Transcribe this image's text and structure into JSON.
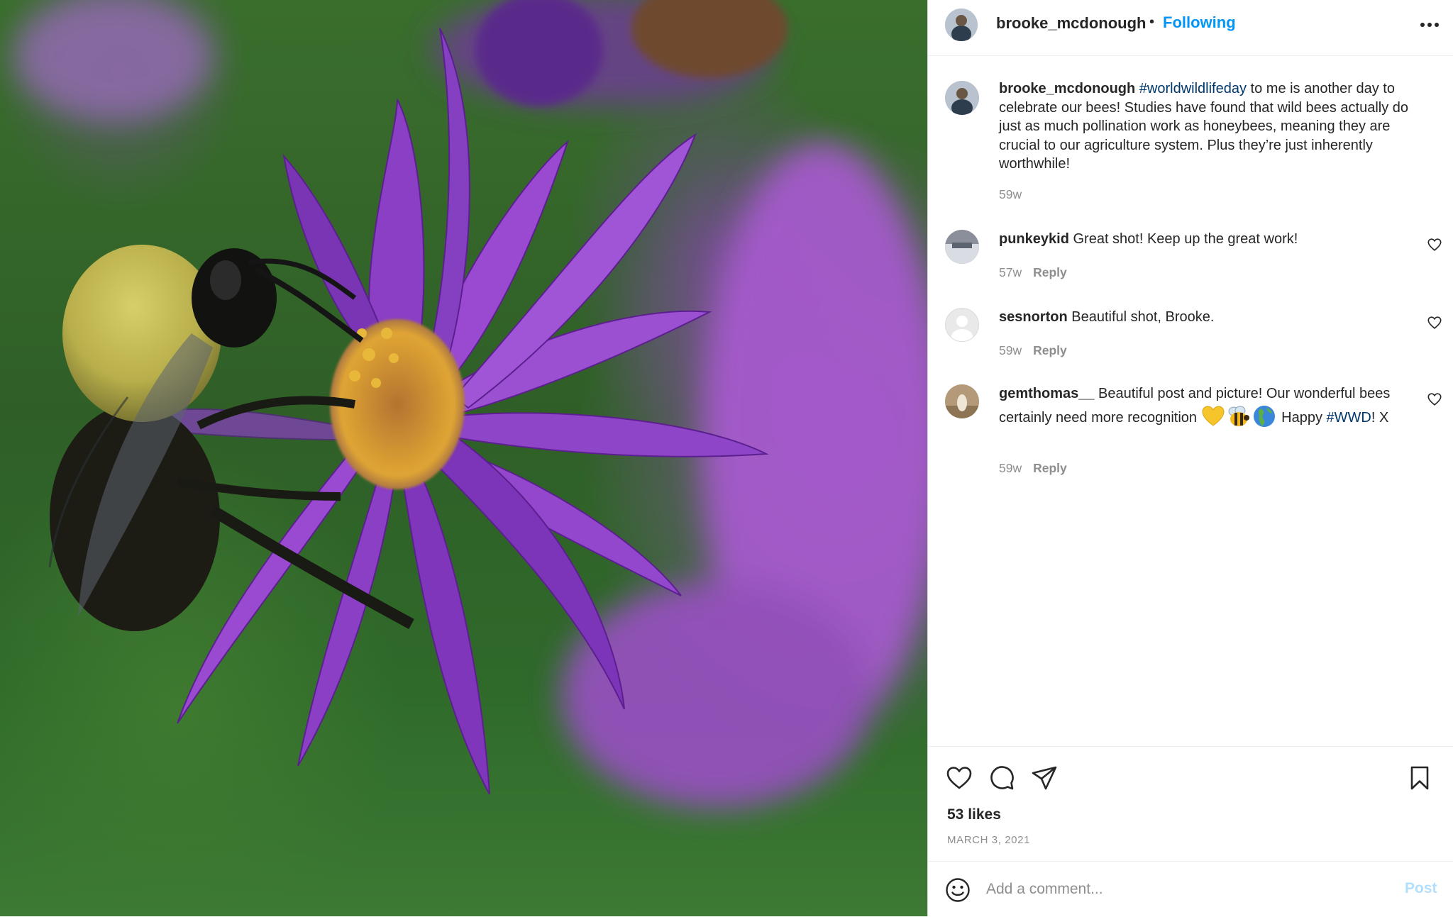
{
  "post": {
    "author": "brooke_mcdonough",
    "separator": "•",
    "follow_status": "Following",
    "more_icon": "more-horizontal-icon",
    "photo": "bumblebee-on-purple-aster-flower"
  },
  "caption": {
    "username": "brooke_mcdonough",
    "hashtag": "#worldwildlifeday",
    "text": " to me is another day to celebrate our bees! Studies have found that wild bees actually do just as much pollination work as honeybees, meaning they are crucial to our agriculture system. Plus they’re just inherently worthwhile!",
    "time": "59w"
  },
  "comments": [
    {
      "username": "punkeykid",
      "text": " Great shot! Keep up the great work!",
      "time": "57w",
      "reply": "Reply",
      "icon": "heart-outline-icon"
    },
    {
      "username": "sesnorton",
      "text": " Beautiful shot, Brooke.",
      "time": "59w",
      "reply": "Reply",
      "icon": "heart-outline-icon"
    },
    {
      "username": "gemthomas__",
      "text": " Beautiful post and picture! Our wonderful bees certainly need more recognition ",
      "emoji": [
        "yellow-heart",
        "honeybee",
        "globe-europe-africa"
      ],
      "text_after": " Happy ",
      "hashtag": "#WWD",
      "text_end": "! X",
      "time": "59w",
      "reply": "Reply",
      "icon": "heart-outline-icon"
    }
  ],
  "actions": {
    "icons": [
      "heart-icon",
      "comment-icon",
      "share-icon",
      "bookmark-icon"
    ],
    "likes": "53 likes",
    "date": "MARCH 3, 2021"
  },
  "comment_box": {
    "placeholder": "Add a comment...",
    "post_label": "Post",
    "emoji_icon": "smiley-icon"
  },
  "colors": {
    "link_blue": "#0095f6",
    "hashtag": "#00376b",
    "muted": "#8e8e8e",
    "post_disabled": "#b2dffc"
  }
}
